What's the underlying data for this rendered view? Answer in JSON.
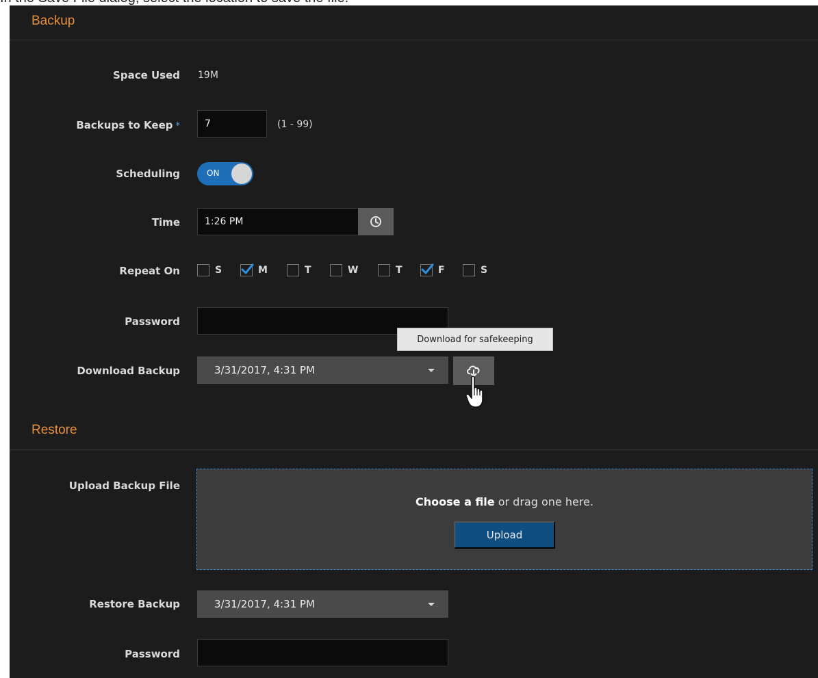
{
  "caption": "In the Save File dialog, select the location to save the file.",
  "backup": {
    "title": "Backup",
    "space_used_label": "Space Used",
    "space_used_value": "19M",
    "keep_label": "Backups to Keep",
    "keep_required": "*",
    "keep_value": "7",
    "keep_range": "(1 - 99)",
    "scheduling_label": "Scheduling",
    "scheduling_state": "ON",
    "time_label": "Time",
    "time_value": "1:26 PM",
    "repeat_label": "Repeat On",
    "days": [
      {
        "label": "S",
        "checked": false
      },
      {
        "label": "M",
        "checked": true
      },
      {
        "label": "T",
        "checked": false
      },
      {
        "label": "W",
        "checked": false
      },
      {
        "label": "T",
        "checked": false
      },
      {
        "label": "F",
        "checked": true
      },
      {
        "label": "S",
        "checked": false
      }
    ],
    "password_label": "Password",
    "password_value": "",
    "download_label": "Download Backup",
    "download_selected": "3/31/2017, 4:31 PM",
    "tooltip": "Download for safekeeping"
  },
  "restore": {
    "title": "Restore",
    "upload_label": "Upload Backup File",
    "choose_bold": "Choose a file",
    "choose_rest": " or drag one here.",
    "upload_button": "Upload",
    "restore_label": "Restore Backup",
    "restore_selected": "3/31/2017, 4:31 PM",
    "password_label": "Password",
    "password_value": ""
  },
  "colors": {
    "background": "#1c1c1c",
    "section_title": "#e8903a",
    "toggle_on": "#1e6fb8",
    "checkbox_checked": "#2f8fe0",
    "upload_button": "#0f4e80",
    "dropzone_border": "#3e86c4"
  }
}
